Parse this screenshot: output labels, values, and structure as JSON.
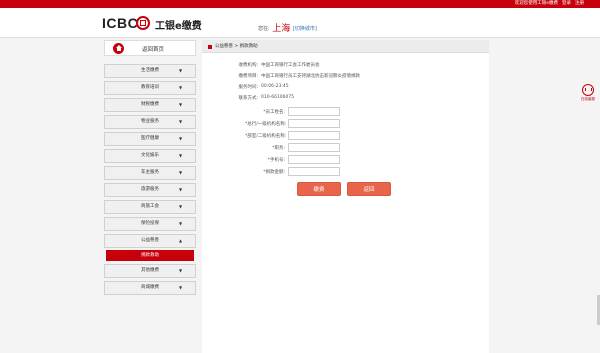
{
  "topbar": {
    "welcome": "欢迎您使用工银e缴费",
    "login": "登录",
    "register": "注册"
  },
  "header": {
    "logo_en": "ICBC",
    "logo_cn": "工银e缴费",
    "city_prefix": "您在:",
    "city_name": "上海",
    "city_switch": "[切换城市]"
  },
  "sidebar": {
    "home_label": "返回首页",
    "items": [
      {
        "label": "生活缴费",
        "arrow": "▼"
      },
      {
        "label": "教育培训",
        "arrow": "▼"
      },
      {
        "label": "财税缴费",
        "arrow": "▼"
      },
      {
        "label": "物业服务",
        "arrow": "▼"
      },
      {
        "label": "医疗健康",
        "arrow": "▼"
      },
      {
        "label": "文化娱乐",
        "arrow": "▼"
      },
      {
        "label": "车主服务",
        "arrow": "▼"
      },
      {
        "label": "旅游服务",
        "arrow": "▼"
      },
      {
        "label": "商旅工会",
        "arrow": "▼"
      },
      {
        "label": "保险投保",
        "arrow": "▼"
      },
      {
        "label": "公益慈善",
        "arrow": "▲"
      }
    ],
    "active_sub": "捐款救助",
    "items_after": [
      {
        "label": "其他缴费",
        "arrow": "▼"
      },
      {
        "label": "商城缴费",
        "arrow": "▼"
      }
    ]
  },
  "breadcrumb": "公益慈善 > 捐款救助",
  "info": [
    {
      "key": "收费机构:",
      "value": "中国工商银行工会工作委员会"
    },
    {
      "key": "缴费项目:",
      "value": "中国工商银行员工支持湖北抗击新冠肺炎疫情捐款"
    },
    {
      "key": "服务时间:",
      "value": "00:06-23:45"
    },
    {
      "key": "联系方式:",
      "value": "010-66106075"
    }
  ],
  "form": [
    {
      "key": "*员工姓名:",
      "value": ""
    },
    {
      "key": "*总行/一级机构名称:",
      "value": ""
    },
    {
      "key": "*部室/二级机构名称:",
      "value": ""
    },
    {
      "key": "*职务:",
      "value": ""
    },
    {
      "key": "*手机号:",
      "value": ""
    },
    {
      "key": "*捐款金额:",
      "value": ""
    }
  ],
  "buttons": {
    "submit": "缴费",
    "back": "返回"
  },
  "service": {
    "label": "在线客服"
  },
  "colors": {
    "brand": "#c7000b",
    "button": "#e8644a"
  }
}
